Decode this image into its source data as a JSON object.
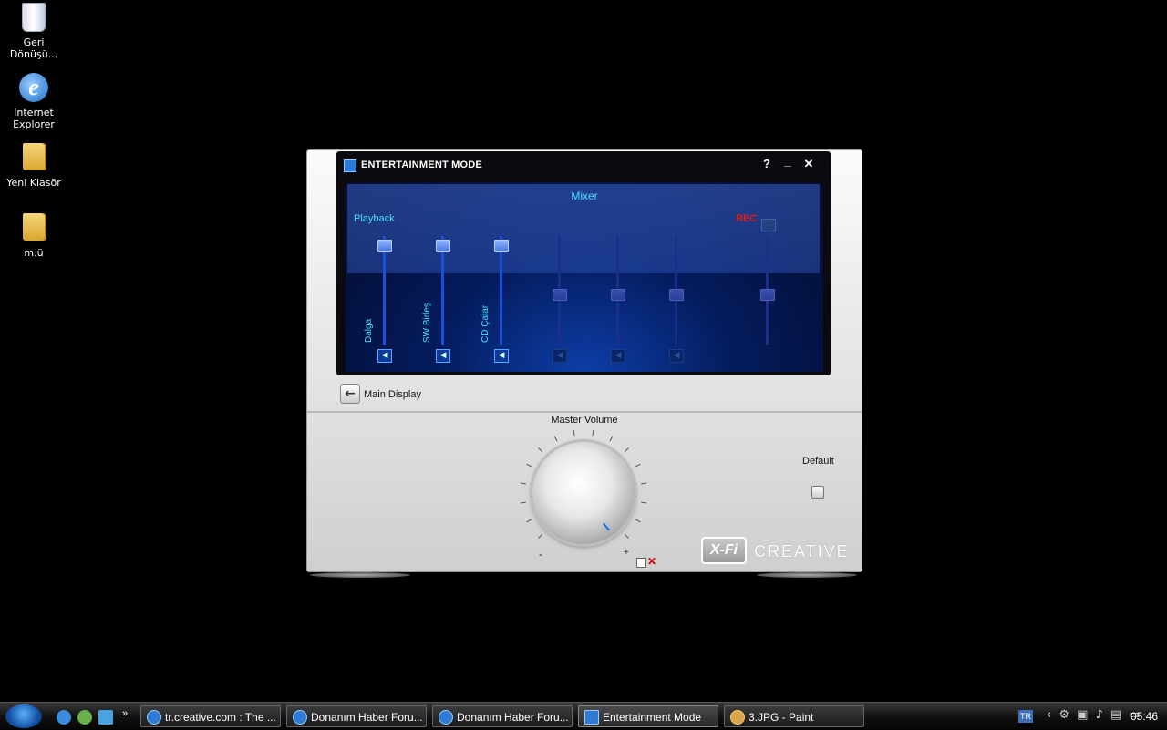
{
  "desktop": {
    "icons": [
      {
        "label": "Geri\nDönüşü...",
        "line1": "Geri",
        "line2": "Dönüşü..."
      },
      {
        "line1": "Internet",
        "line2": "Explorer"
      },
      {
        "line1": "Yeni Klasör"
      },
      {
        "line1": "m.ü"
      }
    ]
  },
  "app": {
    "title": "ENTERTAINMENT MODE",
    "help": "?",
    "minimize": "_",
    "close": "✕",
    "mixer": {
      "title": "Mixer",
      "playback_label": "Playback",
      "rec_label": "REC",
      "channels": [
        {
          "label": "Dalga",
          "level": 0.95,
          "active": true
        },
        {
          "label": "SW Birleş",
          "level": 0.95,
          "active": true
        },
        {
          "label": "CD Çalar",
          "level": 0.95,
          "active": true
        },
        {
          "label": "",
          "level": 0.5,
          "active": false
        },
        {
          "label": "",
          "level": 0.5,
          "active": false
        },
        {
          "label": "",
          "level": 0.5,
          "active": false
        },
        {
          "label": "",
          "level": 0.5,
          "active": false
        }
      ]
    },
    "main_display_label": "Main Display",
    "master_volume_label": "Master Volume",
    "minus": "-",
    "plus": "+",
    "default_label": "Default",
    "brand_xfi": "X-Fi",
    "brand_creative": "CREATIVE"
  },
  "taskbar": {
    "tasks": [
      {
        "label": "tr.creative.com : The ..."
      },
      {
        "label": "Donanım Haber Foru..."
      },
      {
        "label": "Donanım Haber Foru..."
      },
      {
        "label": "Entertainment Mode"
      },
      {
        "label": "3.JPG - Paint"
      }
    ],
    "lang": "TR",
    "clock": "05:46",
    "more": "»"
  }
}
